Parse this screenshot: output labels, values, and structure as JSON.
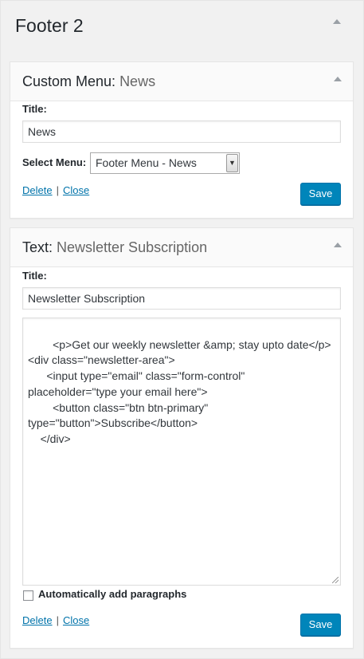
{
  "sidebar": {
    "title": "Footer 2"
  },
  "widget1": {
    "title_prefix": "Custom Menu:",
    "title_suffix": "News",
    "title_label": "Title:",
    "title_value": "News",
    "select_label": "Select Menu:",
    "select_value": "Footer Menu - News",
    "delete_label": "Delete",
    "separator": "|",
    "close_label": "Close",
    "save_label": "Save"
  },
  "widget2": {
    "title_prefix": "Text:",
    "title_suffix": "Newsletter Subscription",
    "title_label": "Title:",
    "title_value": "Newsletter Subscription",
    "content": "<p>Get our weekly newsletter &amp; stay upto date</p>\n<div class=\"newsletter-area\">\n      <input type=\"email\" class=\"form-control\"\nplaceholder=\"type your email here\">\n        <button class=\"btn btn-primary\"\ntype=\"button\">Subscribe</button>\n    </div>",
    "checkbox_label": "Automatically add paragraphs",
    "checkbox_checked": false,
    "delete_label": "Delete",
    "separator": "|",
    "close_label": "Close",
    "save_label": "Save"
  }
}
